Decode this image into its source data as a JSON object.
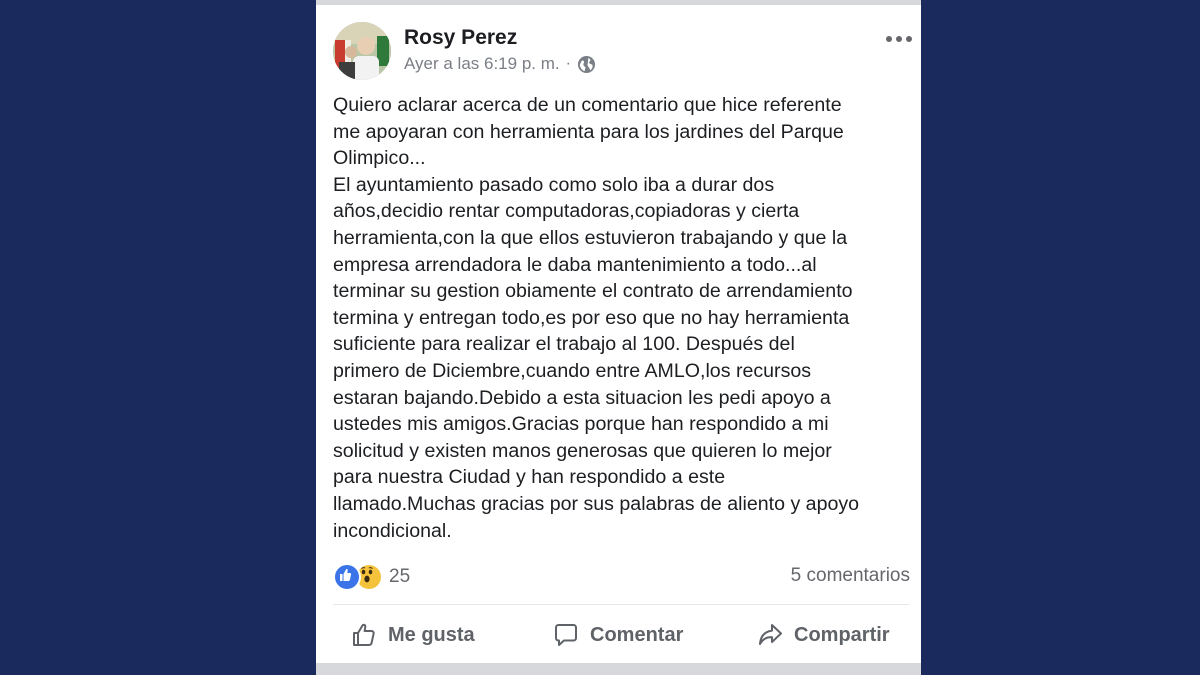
{
  "post": {
    "author": "Rosy Perez",
    "timestamp": "Ayer a las 6:19 p. m.",
    "separator": "·",
    "privacy_icon": "globe-icon",
    "menu_icon": "more-options-icon",
    "body": "Quiero aclarar acerca de  un comentario  que hice referente\nme apoyaran con herramienta para  los jardines del Parque\nOlimpico...\nEl ayuntamiento  pasado como solo iba a durar dos\naños,decidio rentar computadoras,copiadoras y cierta\nherramienta,con la que ellos estuvieron trabajando y que la\nempresa arrendadora le daba mantenimiento a todo...al\nterminar su gestion obiamente el contrato de arrendamiento\ntermina y entregan todo,es por eso que no hay herramienta\nsuficiente para realizar el trabajo al 100. Después del\nprimero de Diciembre,cuando entre AMLO,los recursos\nestaran bajando.Debido a esta situacion les pedi apoyo a\nustedes mis amigos.Gracias porque han respondido a mi\nsolicitud y existen manos generosas que quieren lo mejor\npara nuestra Ciudad y han respondido a este\nllamado.Muchas gracias por sus palabras de aliento y apoyo\nincondicional."
  },
  "reactions": {
    "icons": [
      "like-icon",
      "wow-icon"
    ],
    "count": "25",
    "comments": "5 comentarios"
  },
  "actions": {
    "like": "Me gusta",
    "comment": "Comentar",
    "share": "Compartir"
  },
  "colors": {
    "background": "#1b2a5c",
    "like_blue": "#3b74e8",
    "wow_yellow": "#f5c33b",
    "secondary_text": "#65676b"
  }
}
